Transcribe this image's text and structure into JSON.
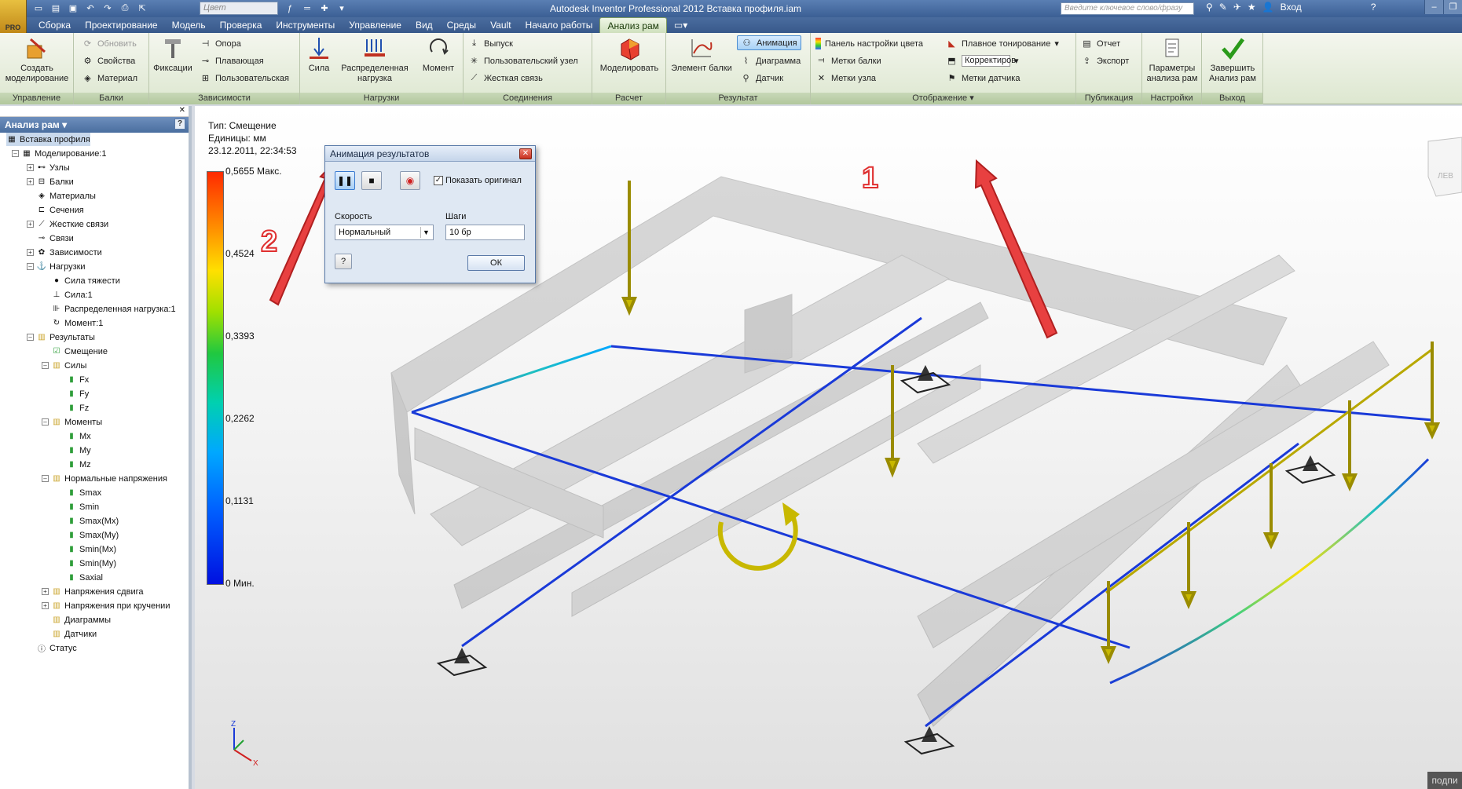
{
  "window": {
    "title": "Autodesk Inventor Professional 2012    Вставка профиля.iam",
    "app_badge": "PRO",
    "color_select": "Цвет",
    "search_placeholder": "Введите ключевое слово/фразу",
    "signin": "Вход"
  },
  "tabs": [
    "Сборка",
    "Проектирование",
    "Модель",
    "Проверка",
    "Инструменты",
    "Управление",
    "Вид",
    "Среды",
    "Vault",
    "Начало работы",
    "Анализ рам"
  ],
  "active_tab": "Анализ рам",
  "ribbon": {
    "groups": {
      "manage": "Управление",
      "beams": "Балки",
      "constraints": "Зависимости",
      "loads": "Нагрузки",
      "connections": "Соединения",
      "solve": "Расчет",
      "result": "Результат",
      "display": "Отображение",
      "publish": "Публикация",
      "settings": "Настройки",
      "exit": "Выход"
    },
    "create_sim": "Создать моделирование",
    "update": "Обновить",
    "properties": "Свойства",
    "material": "Материал",
    "fixed": "Фиксации",
    "pinned": "Опора",
    "floating": "Плавающая",
    "custom": "Пользовательская",
    "force": "Сила",
    "dist_load": "Распределенная нагрузка",
    "moment": "Момент",
    "release": "Выпуск",
    "custom_node": "Пользовательский узел",
    "rigid_link": "Жесткая связь",
    "simulate": "Моделировать",
    "beam_detail": "Элемент балки",
    "animation": "Анимация",
    "diagram": "Диаграмма",
    "probe": "Датчик",
    "color_bar": "Панель настройки цвета",
    "smooth": "Плавное тонирование",
    "beam_labels": "Метки балки",
    "adjust": "Корректиров",
    "node_labels": "Метки узла",
    "probe_labels": "Метки датчика",
    "report": "Отчет",
    "export": "Экспорт",
    "frame_settings": "Параметры анализа рам",
    "finish": "Завершить Анализ рам"
  },
  "browser": {
    "title": "Анализ рам",
    "items": [
      "Вставка профиля",
      "Моделирование:1",
      "Узлы",
      "Балки",
      "Материалы",
      "Сечения",
      "Жесткие связи",
      "Связи",
      "Зависимости",
      "Нагрузки",
      "Сила тяжести",
      "Сила:1",
      "Распределенная нагрузка:1",
      "Момент:1",
      "Результаты",
      "Смещение",
      "Силы",
      "Fx",
      "Fy",
      "Fz",
      "Моменты",
      "Mx",
      "My",
      "Mz",
      "Нормальные напряжения",
      "Smax",
      "Smin",
      "Smax(Mx)",
      "Smax(My)",
      "Smin(Mx)",
      "Smin(My)",
      "Saxial",
      "Напряжения сдвига",
      "Напряжения при кручении",
      "Диаграммы",
      "Датчики",
      "Статус"
    ]
  },
  "viewport": {
    "type": "Тип: Смещение",
    "units": "Единицы: мм",
    "date": "23.12.2011, 22:34:53",
    "legend": [
      "0,5655 Макс.",
      "0,4524",
      "0,3393",
      "0,2262",
      "0,1131",
      "0 Мин."
    ],
    "viewcube_label": "ЛЕВ",
    "corner_text": "подпи"
  },
  "dialog": {
    "title": "Анимация результатов",
    "show_original": "Показать оригинал",
    "show_original_checked": true,
    "speed_label": "Скорость",
    "speed_value": "Нормальный",
    "steps_label": "Шаги",
    "steps_value": "10 бр",
    "ok": "ОК",
    "help": "?"
  },
  "annotations": {
    "one": "1",
    "two": "2"
  },
  "colors": {
    "accent_red": "#e03030",
    "beam_blue": "#1a3ad8",
    "load_yellow": "#b8a800"
  }
}
